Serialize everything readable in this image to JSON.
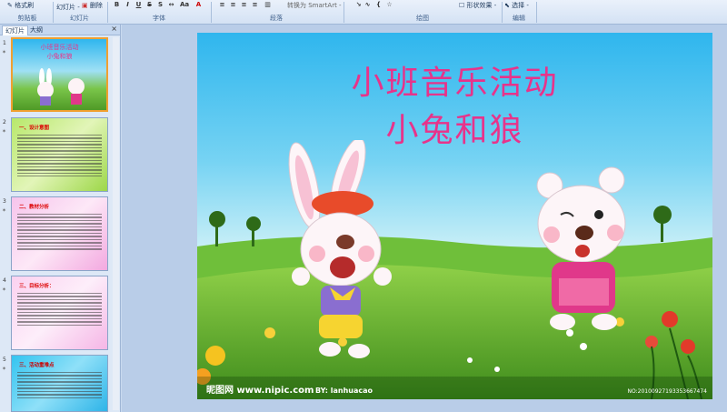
{
  "ribbon": {
    "buttons": {
      "new_slide": "幻灯片 -",
      "format_painter": "格式刷",
      "delete": "删除",
      "convert_smartart": "转换为 SmartArt -",
      "shape_effects": "形状效果 -",
      "select": "选择 -"
    },
    "groups": {
      "clipboard": "剪贴板",
      "slides": "幻灯片",
      "font": "字体",
      "paragraph": "段落",
      "drawing": "绘图",
      "editing": "编辑"
    }
  },
  "left_pane": {
    "tab_slides": "幻灯片",
    "tab_outline": "大纲",
    "close": "×",
    "slide_numbers": [
      "1",
      "2",
      "3",
      "4",
      "5"
    ],
    "thumb1_title_line1": "小班音乐活动",
    "thumb1_title_line2": "小兔和狼",
    "thumb2_heading": "一、设计意图",
    "thumb3_heading": "二、教材分析",
    "thumb4_heading": "三、目标分析：",
    "thumb5_heading": "三、活动重难点"
  },
  "slide": {
    "title_line1": "小班音乐活动",
    "title_line2": "小兔和狼",
    "watermark_logo": "昵图网 www.nipic.com",
    "watermark_author": "BY: lanhuacao",
    "watermark_id": "NO:20100927193353667474"
  },
  "colors": {
    "title": "#e8338a",
    "selected_border": "#f0a030"
  }
}
